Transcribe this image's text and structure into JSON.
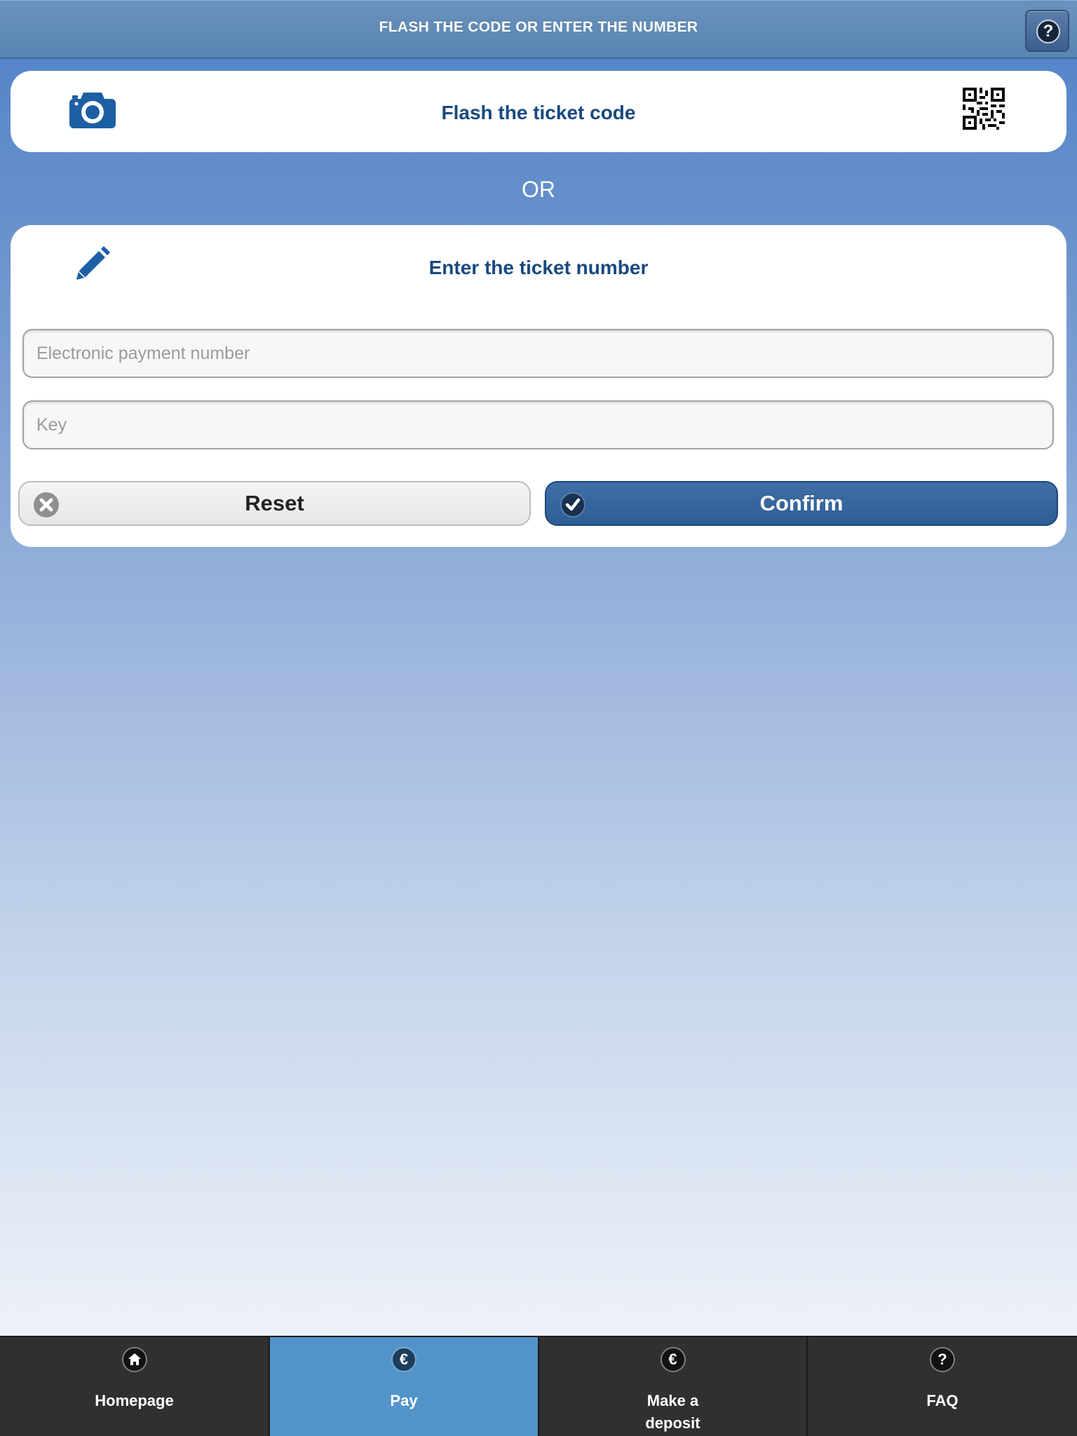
{
  "header": {
    "title": "FLASH THE CODE OR ENTER THE NUMBER",
    "help_icon": "?",
    "help_icon_name": "question-icon"
  },
  "flash_card": {
    "title": "Flash the ticket code",
    "camera_icon": "camera-icon",
    "qr_icon": "qr-code-icon"
  },
  "or_label": "OR",
  "enter_card": {
    "title": "Enter the ticket number",
    "pencil_icon": "pencil-icon",
    "payment_number_placeholder": "Electronic payment number",
    "payment_number_value": "",
    "key_placeholder": "Key",
    "key_value": "",
    "reset_label": "Reset",
    "confirm_label": "Confirm"
  },
  "tabbar": {
    "tabs": [
      {
        "label": "Homepage",
        "icon": "home-icon",
        "active": false
      },
      {
        "label": "Pay",
        "icon": "euro-icon",
        "glyph": "€",
        "active": true
      },
      {
        "label": "Make a deposit",
        "line1": "Make a",
        "line2": "deposit",
        "icon": "euro-icon",
        "glyph": "€",
        "active": false
      },
      {
        "label": "FAQ",
        "icon": "question-icon",
        "glyph": "?",
        "active": false
      }
    ]
  },
  "colors": {
    "accent": "#2d5e96",
    "title_text": "#18497f",
    "tab_active": "#5294c9",
    "tab_background": "#2f3031"
  }
}
